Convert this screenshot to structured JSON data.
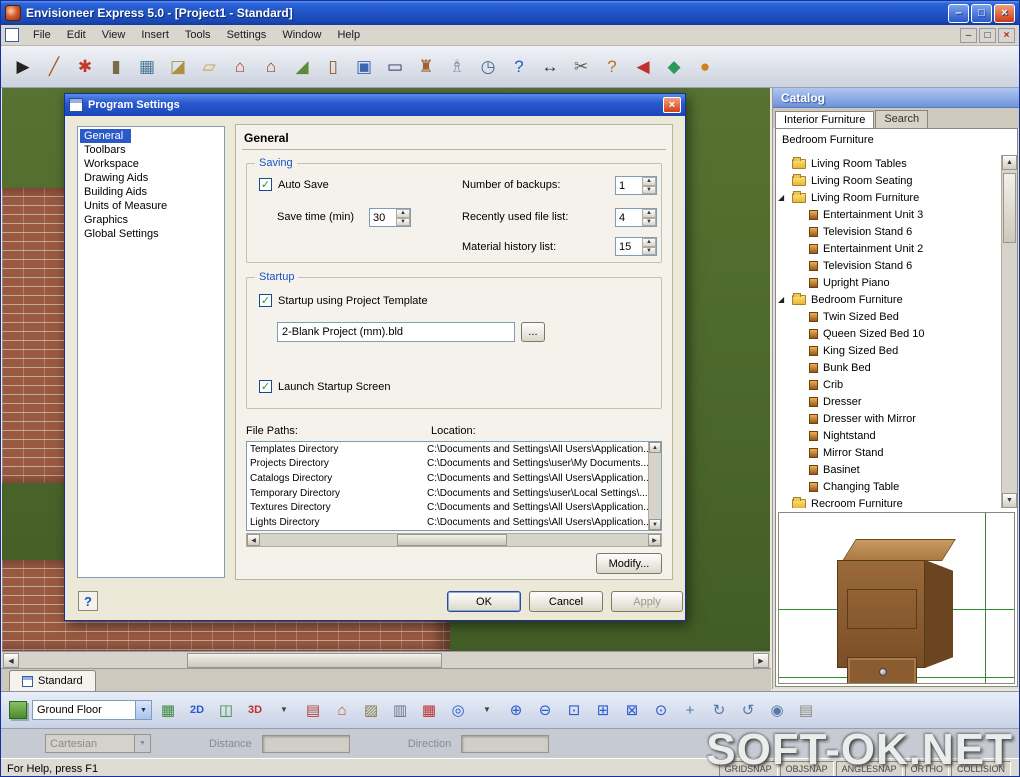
{
  "titlebar": {
    "title": "Envisioneer Express 5.0 - [Project1 - Standard]"
  },
  "glyphs": {
    "minimize": "–",
    "restore": "□",
    "close": "×",
    "dropdown": "▼",
    "up": "▲",
    "down": "▼",
    "left": "◀",
    "right": "▶",
    "check": "✓"
  },
  "menubar": {
    "items": [
      "File",
      "Edit",
      "View",
      "Insert",
      "Tools",
      "Settings",
      "Window",
      "Help"
    ]
  },
  "main_toolbar": {
    "icons": [
      {
        "name": "select-tool-icon",
        "glyph": "▶",
        "color": "#222222"
      },
      {
        "name": "pencil-tool-icon",
        "glyph": "╱",
        "color": "#b05a10"
      },
      {
        "name": "connections-icon",
        "glyph": "✱",
        "color": "#c23a2a"
      },
      {
        "name": "column-tool-icon",
        "glyph": "▮",
        "color": "#7a6a4a"
      },
      {
        "name": "grid-tool-icon",
        "glyph": "▦",
        "color": "#4a7a9a"
      },
      {
        "name": "slab-tool-icon",
        "glyph": "◪",
        "color": "#b0903f"
      },
      {
        "name": "stair-tool-icon",
        "glyph": "▱",
        "color": "#c2a34a"
      },
      {
        "name": "roof-tool-icon",
        "glyph": "⌂",
        "color": "#c03a24"
      },
      {
        "name": "house-tool-icon",
        "glyph": "⌂",
        "color": "#8a4a20"
      },
      {
        "name": "terrain-tool-icon",
        "glyph": "◢",
        "color": "#5a8a3a"
      },
      {
        "name": "door-tool-icon",
        "glyph": "▯",
        "color": "#8a5a24"
      },
      {
        "name": "window-tool-icon",
        "glyph": "▣",
        "color": "#3a66b0"
      },
      {
        "name": "screen-tool-icon",
        "glyph": "▭",
        "color": "#2a3a6a"
      },
      {
        "name": "furniture-tool-icon",
        "glyph": "♜",
        "color": "#a0622e"
      },
      {
        "name": "lamp-tool-icon",
        "glyph": "♗",
        "color": "#8a8a9a"
      },
      {
        "name": "clock-tool-icon",
        "glyph": "◷",
        "color": "#446688"
      },
      {
        "name": "help-book-icon",
        "glyph": "?",
        "color": "#2a5ad0"
      },
      {
        "name": "dimension-tool-icon",
        "glyph": "↔",
        "color": "#333333"
      },
      {
        "name": "cut-tool-icon",
        "glyph": "✂",
        "color": "#606060"
      },
      {
        "name": "assistant-icon",
        "glyph": "?",
        "color": "#c07020"
      },
      {
        "name": "back-arrow-icon",
        "glyph": "◀",
        "color": "#c03030"
      },
      {
        "name": "view-gem-icon",
        "glyph": "◆",
        "color": "#2a9a5a"
      },
      {
        "name": "publish-icon",
        "glyph": "●",
        "color": "#d08020"
      }
    ]
  },
  "dialog": {
    "title": "Program Settings",
    "categories": [
      {
        "label": "General",
        "cls": "selected"
      },
      {
        "label": "Toolbars"
      },
      {
        "label": "Workspace"
      },
      {
        "label": "Drawing Aids"
      },
      {
        "label": "Building Aids"
      },
      {
        "label": "Units of Measure"
      },
      {
        "label": "Graphics"
      },
      {
        "label": "Global Settings"
      }
    ],
    "page_heading": "General",
    "saving": {
      "label": "Saving",
      "auto_save": "Auto Save",
      "save_time_label": "Save time (min)",
      "save_time": "30",
      "backups_label": "Number of backups:",
      "backups": "1",
      "recent_label": "Recently used file list:",
      "recent": "4",
      "material_label": "Material history list:",
      "material": "15"
    },
    "startup": {
      "label": "Startup",
      "use_template": "Startup using Project Template",
      "template_file": "2-Blank Project (mm).bld",
      "browse": "...",
      "launch": "Launch Startup Screen"
    },
    "paths": {
      "col_name": "File Paths:",
      "col_location": "Location:",
      "rows": [
        {
          "name": "Templates Directory",
          "location": "C:\\Documents and Settings\\All Users\\Application..."
        },
        {
          "name": "Projects Directory",
          "location": "C:\\Documents and Settings\\user\\My Documents..."
        },
        {
          "name": "Catalogs Directory",
          "location": "C:\\Documents and Settings\\All Users\\Application..."
        },
        {
          "name": "Temporary Directory",
          "location": "C:\\Documents and Settings\\user\\Local Settings\\..."
        },
        {
          "name": "Textures Directory",
          "location": "C:\\Documents and Settings\\All Users\\Application..."
        },
        {
          "name": "Lights Directory",
          "location": "C:\\Documents and Settings\\All Users\\Application..."
        }
      ]
    },
    "modify": "Modify...",
    "buttons": {
      "ok": "OK",
      "cancel": "Cancel",
      "apply": "Apply"
    },
    "help_glyph": "?"
  },
  "catalog": {
    "title": "Catalog",
    "tabs": [
      {
        "label": "Interior Furniture",
        "cls": "active"
      },
      {
        "label": "Search"
      }
    ],
    "group": "Bedroom Furniture",
    "tree": [
      {
        "label": "Living Room Tables",
        "cls": "folder"
      },
      {
        "label": "Living Room Seating",
        "cls": "folder"
      },
      {
        "label": "Living Room Furniture",
        "cls": "folder open",
        "arrow": "◢"
      },
      {
        "label": "Entertainment Unit 3",
        "cls": "leaf"
      },
      {
        "label": "Television Stand 6",
        "cls": "leaf"
      },
      {
        "label": "Entertainment Unit 2",
        "cls": "leaf"
      },
      {
        "label": "Television Stand 6",
        "cls": "leaf"
      },
      {
        "label": "Upright Piano",
        "cls": "leaf"
      },
      {
        "label": "Bedroom Furniture",
        "cls": "folder open",
        "arrow": "◢"
      },
      {
        "label": "Twin Sized Bed",
        "cls": "leaf"
      },
      {
        "label": "Queen Sized Bed 10",
        "cls": "leaf"
      },
      {
        "label": "King Sized Bed",
        "cls": "leaf"
      },
      {
        "label": "Bunk Bed",
        "cls": "leaf"
      },
      {
        "label": "Crib",
        "cls": "leaf"
      },
      {
        "label": "Dresser",
        "cls": "leaf"
      },
      {
        "label": "Dresser with Mirror",
        "cls": "leaf"
      },
      {
        "label": "Nightstand",
        "cls": "leaf"
      },
      {
        "label": "Mirror Stand",
        "cls": "leaf"
      },
      {
        "label": "Basinet",
        "cls": "leaf"
      },
      {
        "label": "Changing Table",
        "cls": "leaf"
      },
      {
        "label": "Recroom Furniture",
        "cls": "folder"
      }
    ]
  },
  "tabs_row": {
    "standard_tab": "Standard"
  },
  "view_toolbar": {
    "floor_combo": "Ground Floor",
    "icons": [
      {
        "name": "add-level-icon",
        "glyph": "▦",
        "color": "#3a8a3a"
      },
      {
        "name": "view-2d-icon",
        "glyph": "2D",
        "color": "#2a5ad0",
        "cls": "txt"
      },
      {
        "name": "elevation-view-icon",
        "glyph": "◫",
        "color": "#3a8a3a"
      },
      {
        "name": "view-3d-icon",
        "glyph": "3D",
        "color": "#c03030",
        "cls": "txt"
      },
      {
        "name": "view-dropdown-icon",
        "glyph": "▼",
        "color": "#444444",
        "cls": "dd"
      },
      {
        "name": "framing-view-icon",
        "glyph": "▤",
        "color": "#b04030"
      },
      {
        "name": "rendered-view-icon",
        "glyph": "⌂",
        "color": "#b05a20"
      },
      {
        "name": "materials-view-icon",
        "glyph": "▨",
        "color": "#8a7a40"
      },
      {
        "name": "hvac-icon",
        "glyph": "▥",
        "color": "#667788"
      },
      {
        "name": "estimator-icon",
        "glyph": "▦",
        "color": "#c03030"
      },
      {
        "name": "compass-icon",
        "glyph": "◎",
        "color": "#2a5ad0"
      },
      {
        "name": "compass-dropdown-icon",
        "glyph": "▼",
        "color": "#444444",
        "cls": "dd"
      },
      {
        "name": "zoom-in-icon",
        "glyph": "⊕",
        "color": "#2a5ad0"
      },
      {
        "name": "zoom-out-icon",
        "glyph": "⊖",
        "color": "#2a5ad0"
      },
      {
        "name": "zoom-window-icon",
        "glyph": "⊡",
        "color": "#2a5ad0"
      },
      {
        "name": "zoom-region-icon",
        "glyph": "⊞",
        "color": "#2a5ad0"
      },
      {
        "name": "zoom-extents-icon",
        "glyph": "⊠",
        "color": "#2a5ad0"
      },
      {
        "name": "zoom-selected-icon",
        "glyph": "⊙",
        "color": "#2a5ad0"
      },
      {
        "name": "pan-icon",
        "glyph": "+",
        "color": "#5577aa"
      },
      {
        "name": "orbit-icon",
        "glyph": "↻",
        "color": "#5577aa"
      },
      {
        "name": "spin-icon",
        "glyph": "↺",
        "color": "#5577aa"
      },
      {
        "name": "look-icon",
        "glyph": "◉",
        "color": "#5577aa"
      },
      {
        "name": "library-icon",
        "glyph": "▤",
        "color": "#8a8a7a"
      }
    ]
  },
  "edit_bar": {
    "mode": "Cartesian",
    "distance_label": "Distance",
    "direction_label": "Direction"
  },
  "status_bar": {
    "help_text": "For Help, press F1",
    "toggles": [
      "GRIDSNAP",
      "OBJSNAP",
      "ANGLESNAP",
      "ORTHO",
      "COLLISION"
    ]
  },
  "watermark": "SOFT-OK.NET"
}
